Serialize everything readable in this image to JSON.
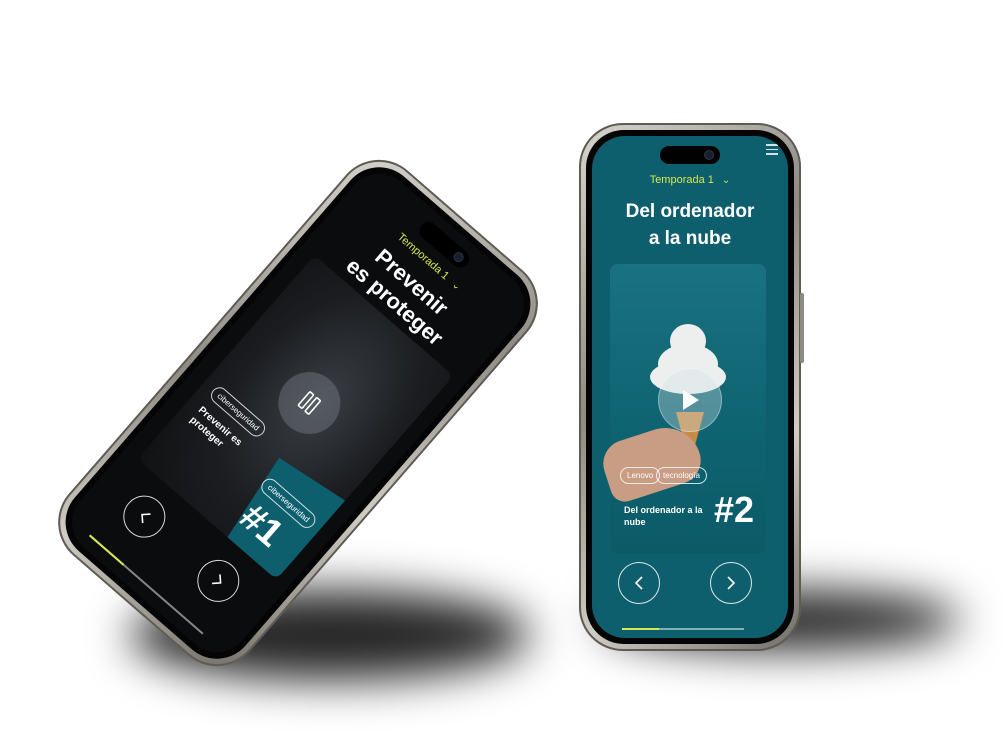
{
  "phone_right": {
    "season_label": "Temporada 1",
    "title_line1": "Del ordenador",
    "title_line2": "a la nube",
    "tags": [
      "Lenovo",
      "tecnología"
    ],
    "episode_title": "Del ordenador a la nube",
    "episode_number": "#2",
    "progress": 0.3
  },
  "phone_left": {
    "season_label": "Temporada 1",
    "title_line1": "Prevenir",
    "title_line2": "es proteger",
    "tags": [
      "ciberseguridad",
      "ciberseguridad"
    ],
    "episode_title": "Prevenir es proteger",
    "episode_number": "#1",
    "progress": 0.3
  },
  "colors": {
    "teal": "#0e5f6d",
    "accent": "#d7e74c",
    "dark": "#0b0c0e"
  },
  "icons": {
    "play": "play-icon",
    "pause": "pause-icon",
    "chevron-left": "chevron-left-icon",
    "chevron-right": "chevron-right-icon",
    "menu": "menu-icon"
  }
}
